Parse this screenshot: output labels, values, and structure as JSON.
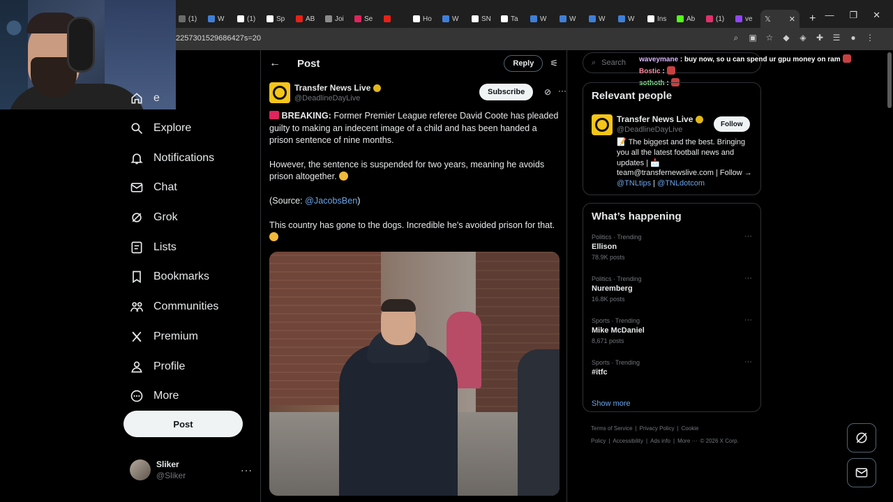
{
  "browser": {
    "tabs": [
      {
        "label": "(1)",
        "color": "#6b6b6b"
      },
      {
        "label": "W",
        "color": "#3f7fd8"
      },
      {
        "label": "(1)",
        "color": "#ffffff"
      },
      {
        "label": "Sp",
        "color": "#ffffff"
      },
      {
        "label": "AB",
        "color": "#e62117"
      },
      {
        "label": "Joi",
        "color": "#8c8c8c"
      },
      {
        "label": "Se",
        "color": "#e0245e"
      },
      {
        "label": "",
        "color": "#e62117"
      },
      {
        "label": "Ho",
        "color": "#ffffff"
      },
      {
        "label": "W",
        "color": "#3f7fd8"
      },
      {
        "label": "SN",
        "color": "#ffffff"
      },
      {
        "label": "Ta",
        "color": "#ffffff"
      },
      {
        "label": "W",
        "color": "#3f7fd8"
      },
      {
        "label": "W",
        "color": "#3f7fd8"
      },
      {
        "label": "W",
        "color": "#3f7fd8"
      },
      {
        "label": "W",
        "color": "#3f7fd8"
      },
      {
        "label": "Ins",
        "color": "#ffffff"
      },
      {
        "label": "Ab",
        "color": "#53fc18"
      },
      {
        "label": "(1)",
        "color": "#e1306c"
      },
      {
        "label": "ve",
        "color": "#9146ff"
      }
    ],
    "active_tab_label": "",
    "url": "2257301529686427s=20"
  },
  "nav": {
    "items": [
      {
        "label": "e",
        "icon": "home-icon"
      },
      {
        "label": "Explore",
        "icon": "search-icon"
      },
      {
        "label": "Notifications",
        "icon": "bell-icon"
      },
      {
        "label": "Chat",
        "icon": "mail-icon"
      },
      {
        "label": "Grok",
        "icon": "grok-icon"
      },
      {
        "label": "Lists",
        "icon": "list-icon"
      },
      {
        "label": "Bookmarks",
        "icon": "bookmark-icon"
      },
      {
        "label": "Communities",
        "icon": "people-icon"
      },
      {
        "label": "Premium",
        "icon": "x-icon"
      },
      {
        "label": "Profile",
        "icon": "person-icon"
      },
      {
        "label": "More",
        "icon": "more-circle-icon"
      }
    ],
    "post_label": "Post",
    "account": {
      "name": "Sliker",
      "handle": "@Sliker"
    }
  },
  "main": {
    "title": "Post",
    "reply_label": "Reply",
    "tweet": {
      "author": "Transfer News Live",
      "handle": "@DeadlineDayLive",
      "subscribe_label": "Subscribe",
      "breaking": "BREAKING:",
      "para1": " Former Premier League referee David Coote has pleaded guilty to making an indecent image of a child and has been handed a prison sentence of nine months.",
      "para2": "However, the sentence is suspended for two years, meaning he avoids prison altogether.",
      "source_prefix": "(Source: ",
      "source_link": "@JacobsBen",
      "source_suffix": ")",
      "para4": "This country has gone to the dogs. Incredible he's avoided prison for that."
    }
  },
  "right": {
    "search_placeholder": "Search",
    "chat": [
      {
        "user": "waveymane",
        "msg": " : buy now, so u can spend ur gpu money on ram"
      },
      {
        "user": "Bostic",
        "msg": " :"
      },
      {
        "user": "sothoth",
        "msg": " :"
      }
    ],
    "relevant": {
      "title": "Relevant people",
      "name": "Transfer News Live",
      "handle": "@DeadlineDayLive",
      "follow_label": "Follow",
      "bio_text": "The biggest and the best. Bringing you all the latest football news and updates |",
      "bio_email": "team@transfernewslive.com | Follow →",
      "bio_link1": "@TNLtips",
      "bio_sep": " | ",
      "bio_link2": "@TNLdotcom"
    },
    "happening": {
      "title": "What’s happening",
      "trends": [
        {
          "category": "Politics · Trending",
          "name": "Ellison",
          "count": "78.9K posts"
        },
        {
          "category": "Politics · Trending",
          "name": "Nuremberg",
          "count": "16.8K posts"
        },
        {
          "category": "Sports · Trending",
          "name": "Mike McDaniel",
          "count": "8,671 posts"
        },
        {
          "category": "Sports · Trending",
          "name": "#itfc",
          "count": ""
        }
      ],
      "show_more": "Show more"
    },
    "footer": [
      "Terms of Service",
      "|",
      "Privacy Policy",
      "|",
      "Cookie Policy",
      "|",
      "Accessibility",
      "|",
      "Ads info",
      "|",
      "More ···",
      "© 2026 X Corp."
    ]
  },
  "colors": {
    "accent": "#1d9bf0",
    "link": "#6ba4e8",
    "badge": "#e2b719"
  }
}
